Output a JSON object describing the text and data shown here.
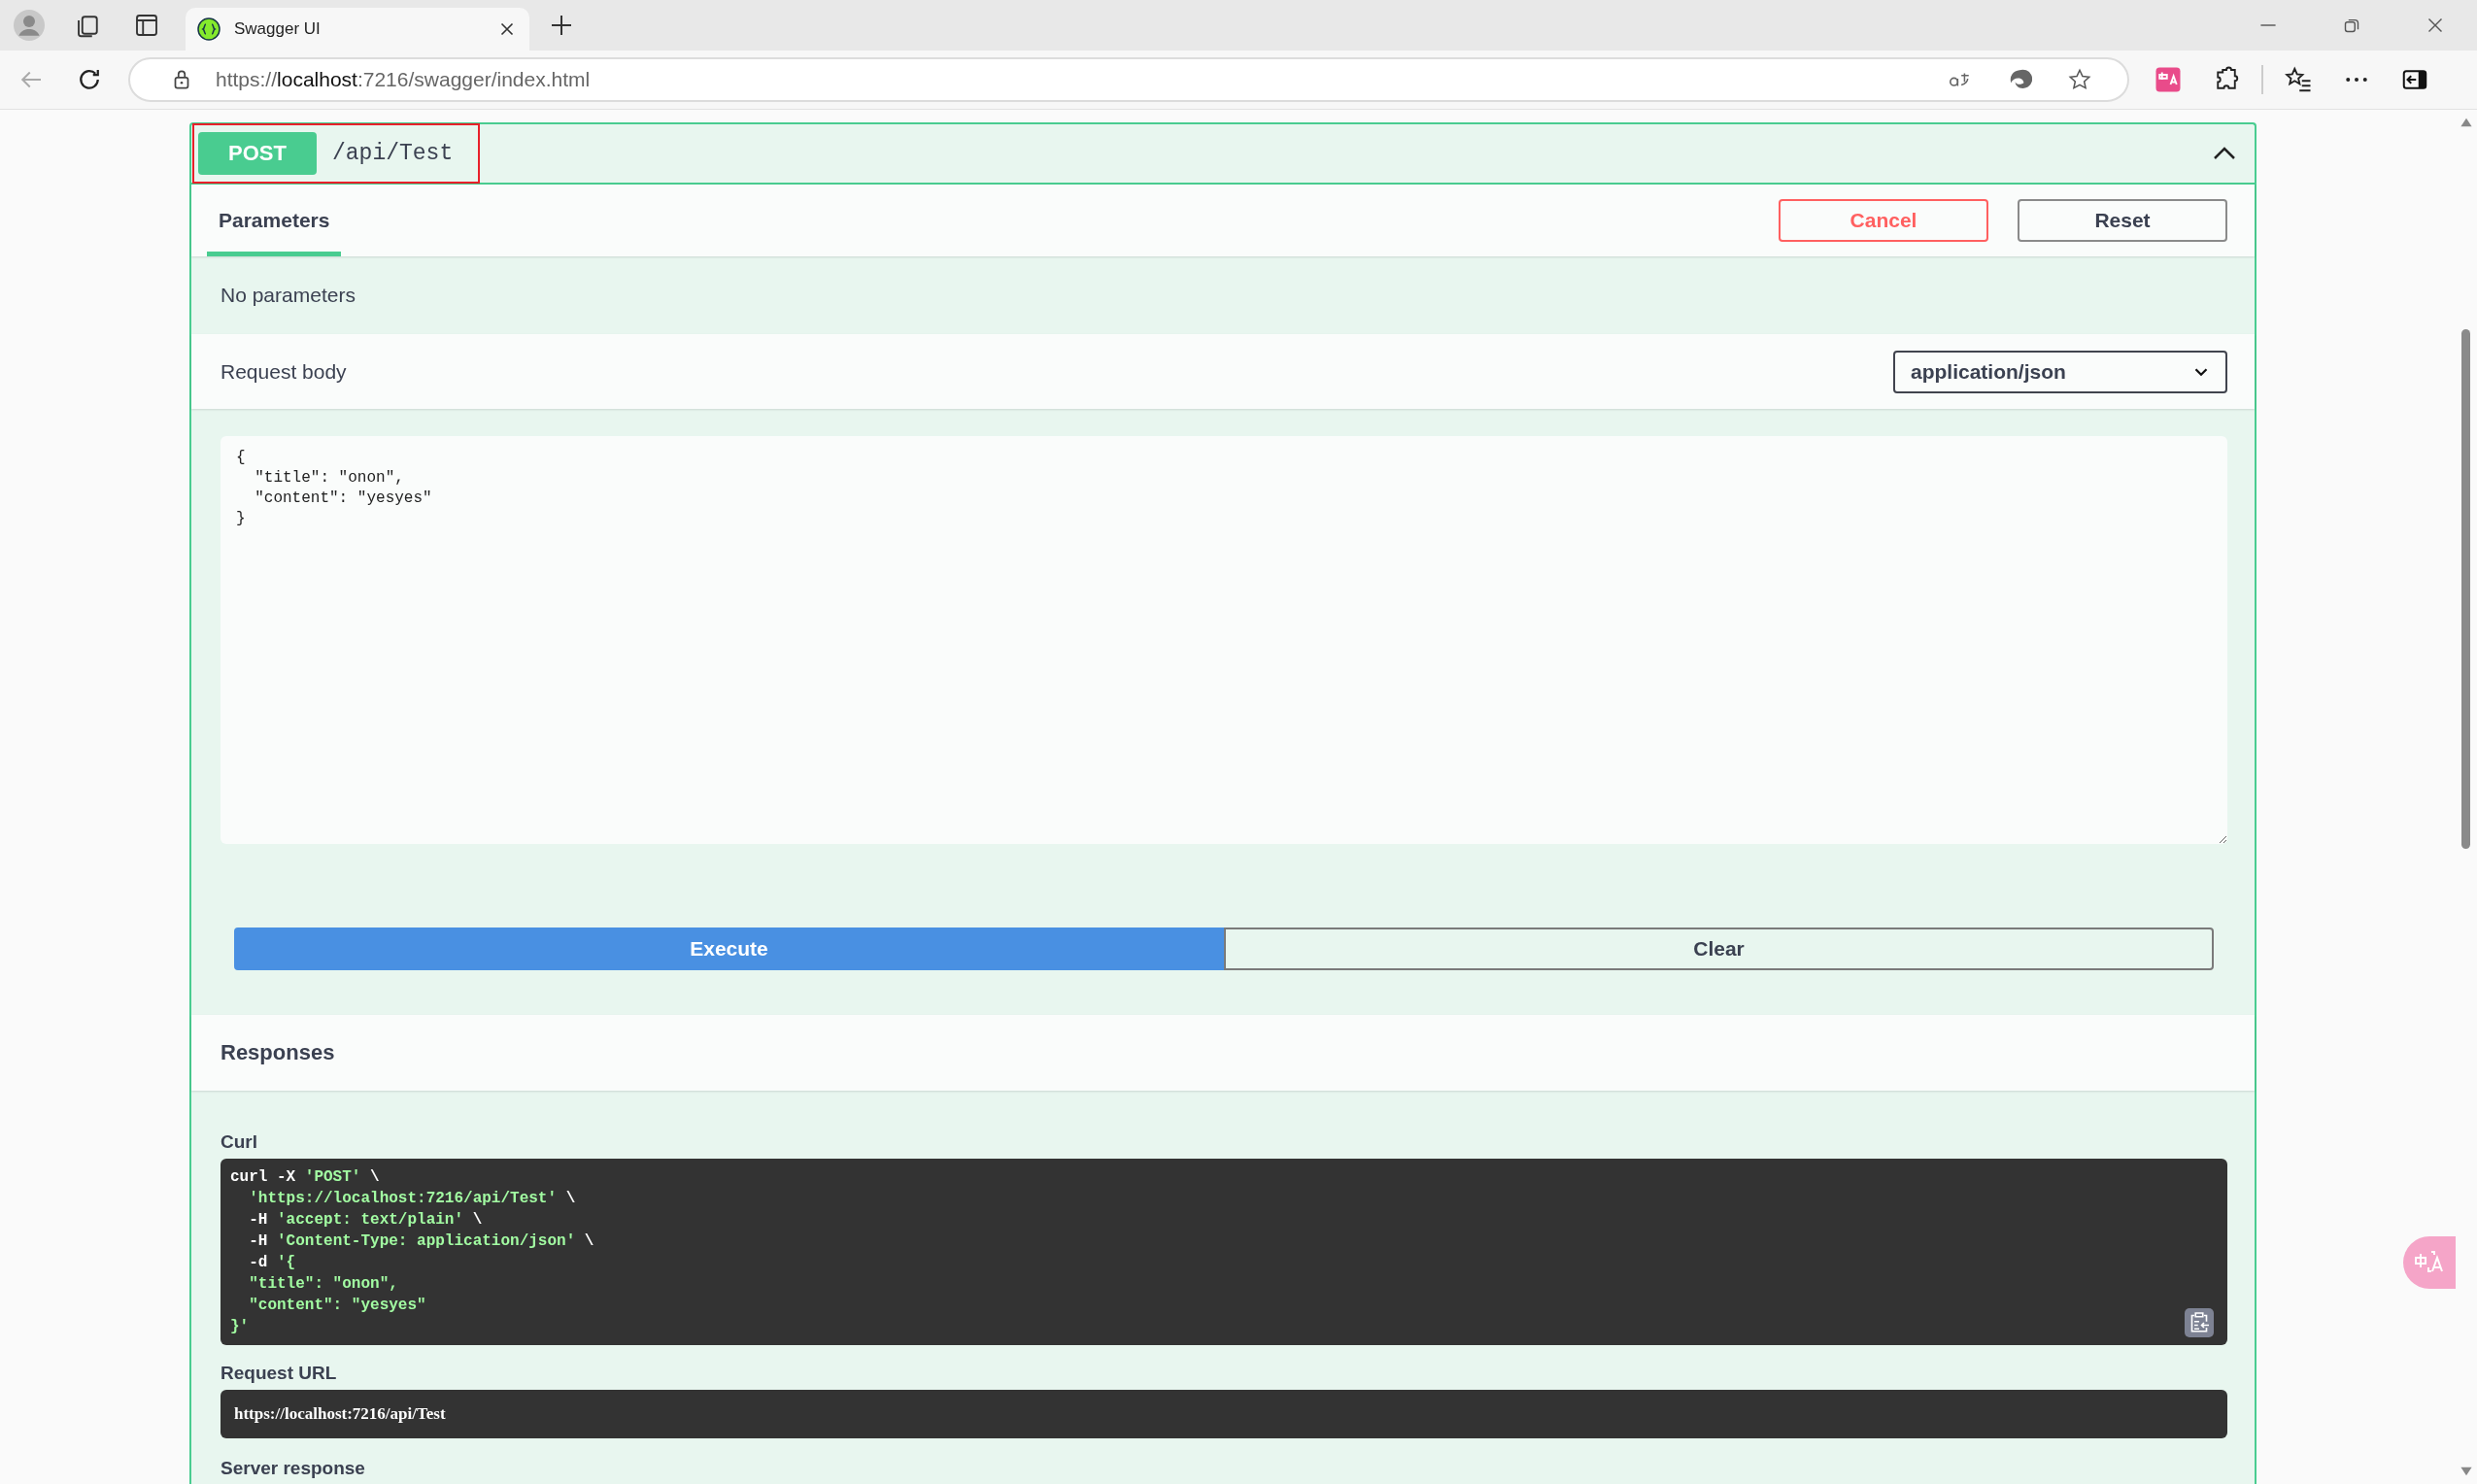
{
  "browser": {
    "tab_title": "Swagger UI",
    "url_scheme": "https://",
    "url_host": "localhost",
    "url_rest": ":7216/swagger/index.html"
  },
  "operation": {
    "method": "POST",
    "path": "/api/Test",
    "expanded": true
  },
  "tabs": [
    {
      "label": "Parameters",
      "selected": true
    }
  ],
  "buttons": {
    "cancel": "Cancel",
    "reset": "Reset"
  },
  "parameters_text": "No parameters",
  "request_body": {
    "label": "Request body",
    "content_type": "application/json",
    "value": "{\n  \"title\": \"onon\",\n  \"content\": \"yesyes\"\n}"
  },
  "actions": {
    "execute": "Execute",
    "clear": "Clear"
  },
  "responses": {
    "title": "Responses",
    "curl_label": "Curl",
    "curl": [
      [
        {
          "kind": "plain",
          "text": "curl -X "
        },
        {
          "kind": "string",
          "text": "'POST'"
        },
        {
          "kind": "plain",
          "text": " \\"
        }
      ],
      [
        {
          "kind": "string",
          "text": "  'https://localhost:7216/api/Test'"
        },
        {
          "kind": "plain",
          "text": " \\"
        }
      ],
      [
        {
          "kind": "plain",
          "text": "  -H "
        },
        {
          "kind": "string",
          "text": "'accept: text/plain'"
        },
        {
          "kind": "plain",
          "text": " \\"
        }
      ],
      [
        {
          "kind": "plain",
          "text": "  -H "
        },
        {
          "kind": "string",
          "text": "'Content-Type: application/json'"
        },
        {
          "kind": "plain",
          "text": " \\"
        }
      ],
      [
        {
          "kind": "plain",
          "text": "  -d "
        },
        {
          "kind": "string",
          "text": "'{"
        }
      ],
      [
        {
          "kind": "string",
          "text": "  \"title\": \"onon\","
        }
      ],
      [
        {
          "kind": "string",
          "text": "  \"content\": \"yesyes\""
        }
      ],
      [
        {
          "kind": "string",
          "text": "}'"
        }
      ]
    ],
    "request_url_label": "Request URL",
    "request_url": "https://localhost:7216/api/Test",
    "server_response_label": "Server response"
  }
}
